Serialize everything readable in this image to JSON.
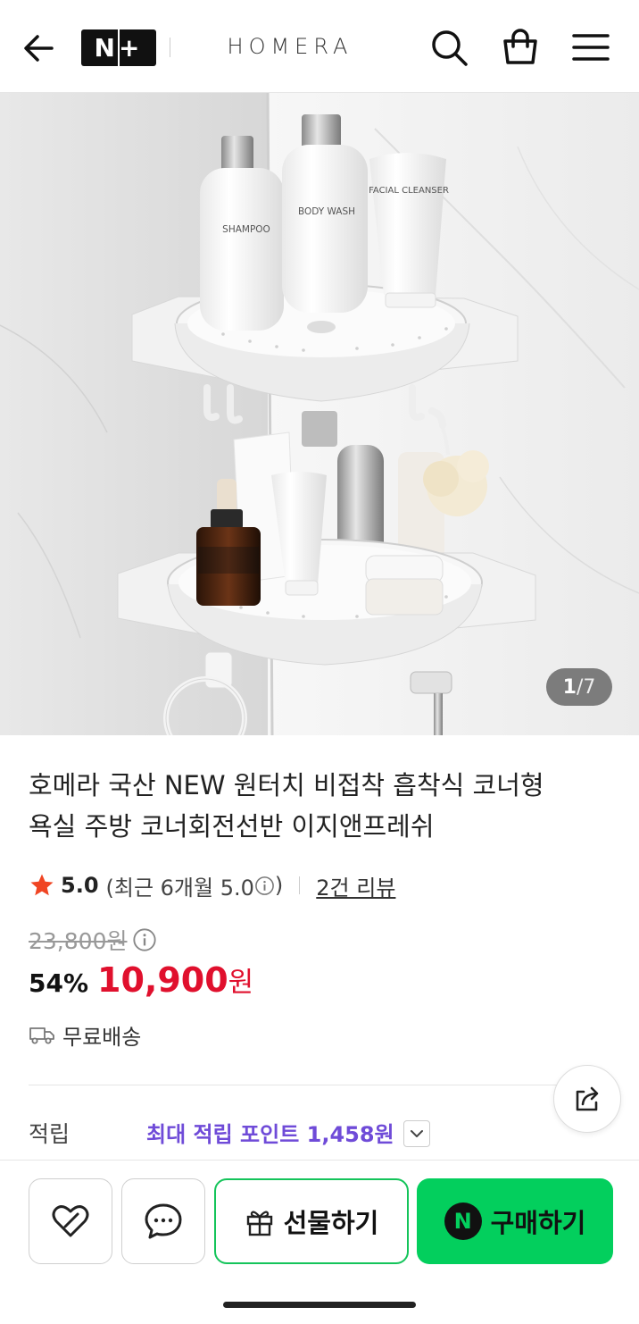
{
  "header": {
    "brand_badge": "N+",
    "brand_name": "HOMERA"
  },
  "gallery": {
    "current": "1",
    "separator": "/",
    "total": "7",
    "bottle_labels": {
      "shampoo": "SHAMPOO",
      "body_wash": "BODY WASH",
      "facial_cleanser": "FACIAL CLEANSER"
    }
  },
  "product": {
    "title_line1": "호메라 국산 NEW 원터치 비접착 흡착식 코너형",
    "title_line2": "욕실 주방 코너회전선반 이지앤프레쉬",
    "rating": "5.0",
    "recent_rating": "(최근 6개월 5.0",
    "recent_rating_close": ")",
    "review_count": "2건 리뷰",
    "original_price": "23,800원",
    "discount": "54%",
    "price": "10,900",
    "currency": "원",
    "shipping": "무료배송",
    "points_label": "적립",
    "points_value": "최대 적립 포인트 1,458원"
  },
  "bottom_bar": {
    "gift_label": "선물하기",
    "buy_badge": "N",
    "buy_label": "구매하기"
  },
  "colors": {
    "price_red": "#e0102d",
    "npay_green": "#03cf5d",
    "points_purple": "#6f4bd8"
  }
}
